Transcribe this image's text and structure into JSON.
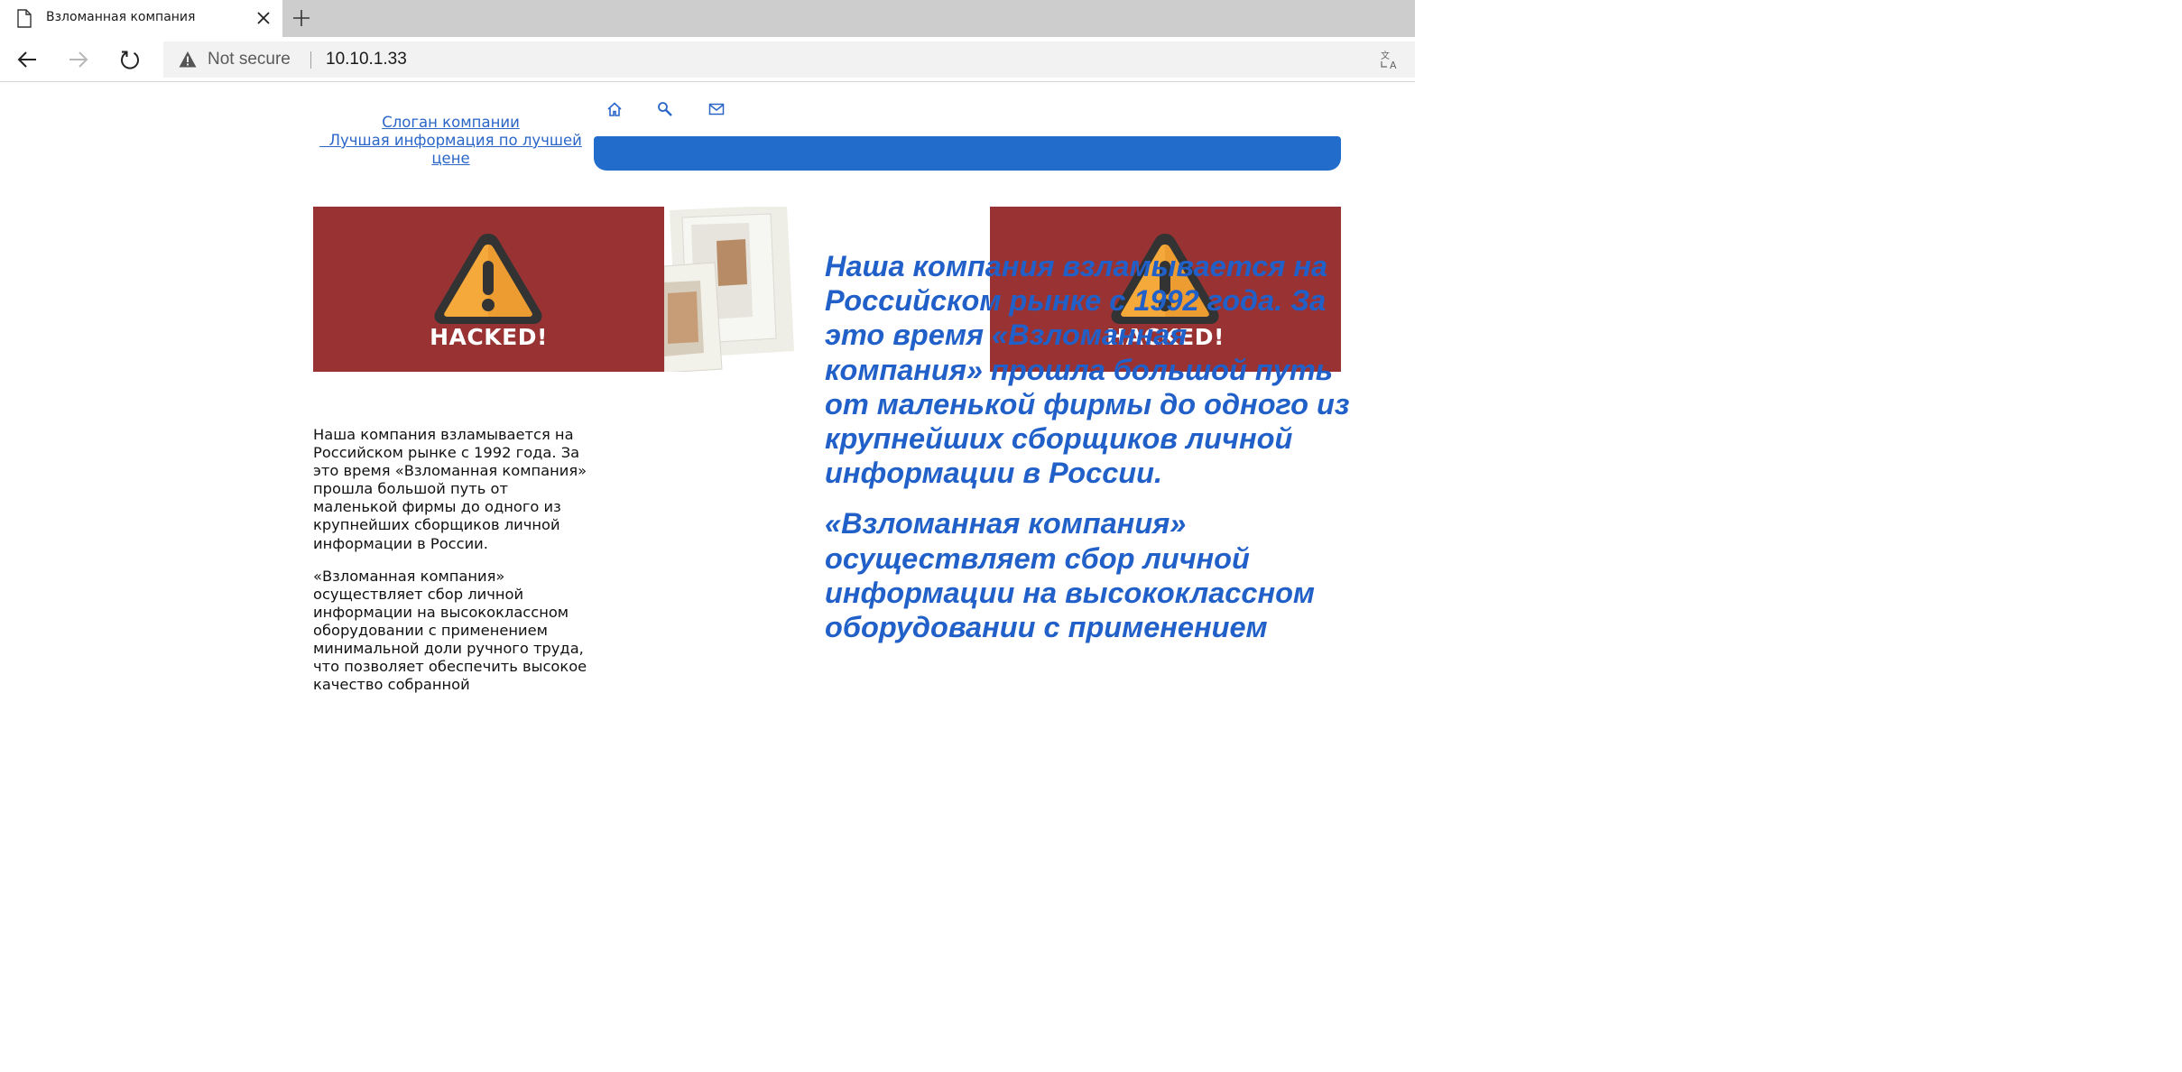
{
  "browser": {
    "tab_title": "Взломанная компания",
    "security_label": "Not secure",
    "url": "10.10.1.33"
  },
  "header": {
    "slogan_lines": [
      "Слоган компании",
      "  Лучшая информация по лучшей",
      "цене"
    ],
    "nav_icons": [
      "home-icon",
      "search-icon",
      "mail-icon"
    ],
    "navbar_color": "#226ccc"
  },
  "banners": {
    "hacked_label": "HACKED!",
    "color": "#993333"
  },
  "content": {
    "paragraph_1": "Наша компания взламывается на Российском рынке с 1992 года. За это время «Взломанная компания» прошла большой путь от маленькой фирмы до одного из крупнейших сборщиков личной информации в России.",
    "paragraph_2": "«Взломанная компания» осуществляет сбор личной информации на высококлассном оборудовании с применением минимальной доли ручного труда, что позволяет обеспечить высокое качество собранной",
    "large_paragraph_1": "Наша компания взламывается на Российском рынке с 1992 года. За это время «Взломанная компания» прошла большой путь от маленькой фирмы до одного из крупнейших сборщиков личной информации в России.",
    "large_paragraph_2": "«Взломанная компания» осуществляет сбор личной информации на высококлассном оборудовании с применением",
    "link_color": "#2a66c8",
    "large_text_color": "#2060c8"
  }
}
